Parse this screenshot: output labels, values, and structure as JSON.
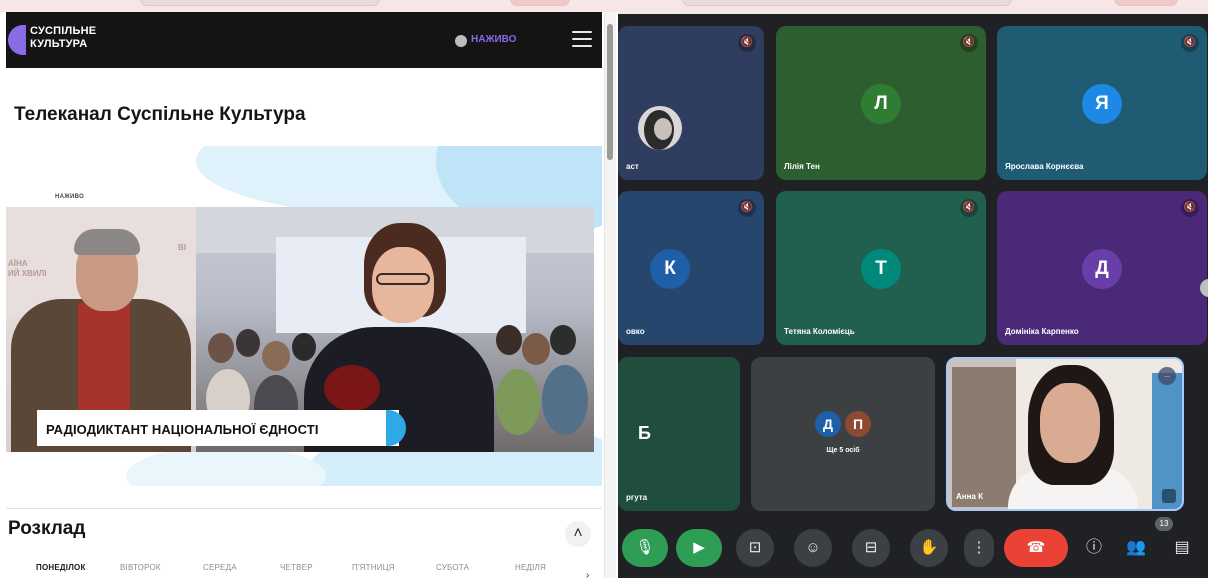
{
  "left_pane": {
    "site": {
      "logo_line1": "СУСПІЛЬНЕ",
      "logo_line2": "КУЛЬТУРА",
      "live_label": "НАЖИВО",
      "brand_color": "#8b67e8"
    },
    "channel_title": "Телеканал Суспільне Культура",
    "hero": {
      "live_small": "НАЖИВО",
      "studio_text_1": "АЇНА",
      "studio_text_2": "ИЙ ХВИЛІ",
      "studio_text_3": "ВІ",
      "caption": "РАДІОДИКТАНТ НАЦІОНАЛЬНОЇ ЄДНОСТІ"
    },
    "schedule": {
      "title": "Розклад",
      "days": [
        "ПОНЕДІЛОК",
        "ВІВТОРОК",
        "СЕРЕДА",
        "ЧЕТВЕР",
        "П'ЯТНИЦЯ",
        "СУБОТА",
        "НЕДІЛЯ"
      ],
      "active_day": "ПОНЕДІЛОК"
    }
  },
  "meeting": {
    "participants": [
      {
        "initial": "",
        "name": "аст",
        "bg": "#2f3e5e",
        "avatar_bg": ""
      },
      {
        "initial": "Л",
        "name": "Лілія Тен",
        "bg": "#2d5e2f",
        "avatar_bg": "#2e7d32"
      },
      {
        "initial": "Я",
        "name": "Ярослава Корнєєва",
        "bg": "#1f5c74",
        "avatar_bg": "#1e88e5"
      },
      {
        "initial": "К",
        "name": "овко",
        "bg": "#27466e",
        "avatar_bg": "#1e5fa8"
      },
      {
        "initial": "Т",
        "name": "Тетяна Коломієць",
        "bg": "#21604f",
        "avatar_bg": "#00897b"
      },
      {
        "initial": "Д",
        "name": "Домініка Карпенко",
        "bg": "#4a2a78",
        "avatar_bg": "#6a3ea8"
      },
      {
        "initial": "Б",
        "name": "ргута",
        "bg": "#1f4e3c",
        "avatar_bg": ""
      }
    ],
    "others_tile": {
      "avatars": [
        {
          "initial": "Д",
          "bg": "#1e5fa8"
        },
        {
          "initial": "П",
          "bg": "#8d4a32"
        }
      ],
      "label": "Ще 5 осіб"
    },
    "camera_tile": {
      "name": "Анна К",
      "badge": "..."
    },
    "participant_count": "13",
    "icons": {
      "mic": "microphone-icon",
      "camera": "camera-icon",
      "present": "present-screen-icon",
      "emoji": "emoji-icon",
      "captions": "captions-icon",
      "hand": "raise-hand-icon",
      "more": "more-vertical-icon",
      "leave": "leave-call-icon",
      "info": "info-icon",
      "people": "people-icon",
      "chat": "chat-icon"
    },
    "glyphs": {
      "mic": "🎙",
      "camera": "▶",
      "present": "⊡",
      "emoji": "☺",
      "captions": "⊟",
      "hand": "✋",
      "more": "⋮",
      "leave": "☎",
      "info": "ⓘ",
      "people": "👥",
      "chat": "▤",
      "mic_off": "🔇"
    }
  }
}
